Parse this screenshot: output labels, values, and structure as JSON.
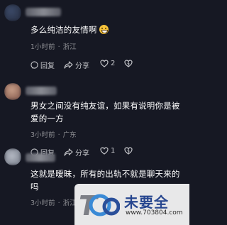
{
  "comments": [
    {
      "text": "多么纯洁的友情啊",
      "emoji": "grinning-face",
      "time": "1小时前",
      "location": "浙江",
      "reply_label": "回复",
      "share_label": "分享",
      "like_count": "2"
    },
    {
      "text": "男女之间没有纯友谊，如果有说明你是被爱的一方",
      "time": "3小时前",
      "location": "广东",
      "like_count": "1"
    },
    {
      "text": "这就是暧昧，所有的出轨不就是聊天来的吗",
      "time": "3小时前",
      "location": "浙江"
    }
  ],
  "meta_separator": "·",
  "watermark": {
    "name": "未要全",
    "url": "www.703804.com"
  },
  "colors": {
    "background": "#161823",
    "text": "#ffffff",
    "meta": "#8b8c91",
    "action": "#c5c6ca",
    "watermark_brand": "#27468f"
  },
  "icons": [
    "reply-icon",
    "share-icon",
    "heart-icon",
    "dislike-icon",
    "emoji-icon"
  ]
}
